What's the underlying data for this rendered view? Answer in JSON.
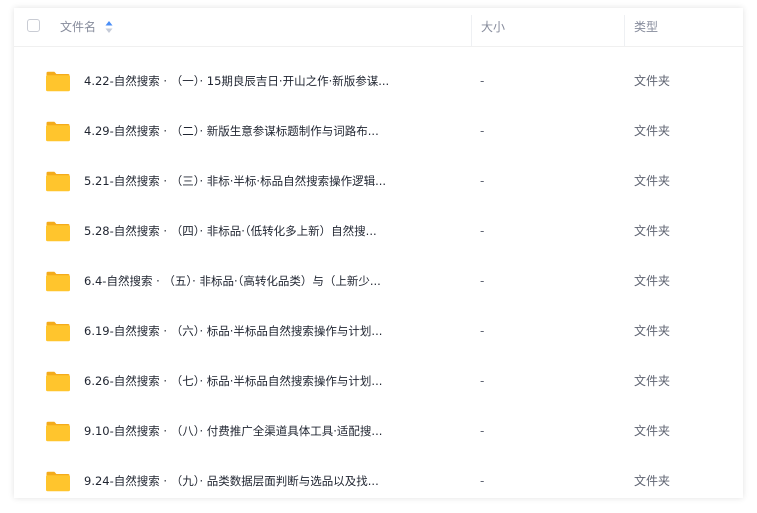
{
  "header": {
    "name_label": "文件名",
    "size_label": "大小",
    "type_label": "类型"
  },
  "colors": {
    "folder": "#ffc52d",
    "folder_tab": "#f4ab1c",
    "sort_active": "#4a8ef7"
  },
  "icons": {
    "checkbox": "checkbox-icon",
    "sort": "sort-icon",
    "folder": "folder-icon"
  },
  "rows": [
    {
      "name": "4.22-自然搜索 · （一）· 15期良辰吉日·开山之作·新版参谋...",
      "size": "-",
      "type": "文件夹"
    },
    {
      "name": "4.29-自然搜索 · （二）· 新版生意参谋标题制作与词路布...",
      "size": "-",
      "type": "文件夹"
    },
    {
      "name": "5.21-自然搜索 · （三）· 非标·半标·标品自然搜索操作逻辑...",
      "size": "-",
      "type": "文件夹"
    },
    {
      "name": "5.28-自然搜索 · （四）· 非标品·（低转化多上新）自然搜...",
      "size": "-",
      "type": "文件夹"
    },
    {
      "name": "6.4-自然搜索 · （五）· 非标品·（高转化品类）与（上新少...",
      "size": "-",
      "type": "文件夹"
    },
    {
      "name": "6.19-自然搜索 · （六）· 标品·半标品自然搜索操作与计划...",
      "size": "-",
      "type": "文件夹"
    },
    {
      "name": "6.26-自然搜索 · （七）· 标品·半标品自然搜索操作与计划...",
      "size": "-",
      "type": "文件夹"
    },
    {
      "name": "9.10-自然搜索 · （八）· 付费推广全渠道具体工具·适配搜...",
      "size": "-",
      "type": "文件夹"
    },
    {
      "name": "9.24-自然搜索 · （九）· 品类数据层面判断与选品以及找...",
      "size": "-",
      "type": "文件夹"
    }
  ]
}
